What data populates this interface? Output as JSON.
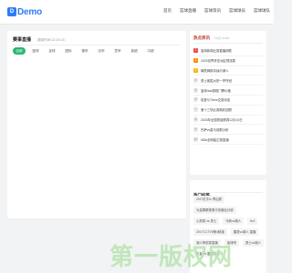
{
  "header": {
    "logo_badge": "D",
    "logo_text": "Demo",
    "nav": [
      "首页",
      "篮球直播",
      "篮球资讯",
      "篮球球员",
      "篮球球队"
    ]
  },
  "schedule": {
    "title": "赛事直播",
    "subtitle": "（更新时间 12-09-01）",
    "tabs": [
      "全部",
      "篮球",
      "足球",
      "国际",
      "德甲",
      "法甲",
      "意甲",
      "英超",
      "中超"
    ],
    "active_tab": 0
  },
  "hot": {
    "title": "热点资讯",
    "subtitle": "（今日 12:00）",
    "items": [
      "篮球新闻比赛直播前瞻",
      "2023世界杯亚洲区预选赛",
      "曝詹姆斯将续约湖人",
      "勇士客胜太阳一举夺冠",
      "篮球nba赛程门票价格",
      "哈登与76ers交易消息",
      "第十三场比赛精彩回顾",
      "2023年全国男篮联赛12月10日",
      "巴萨vs皇马前瞻分析",
      "NBA全明星正赛直播"
    ]
  },
  "tags": {
    "title": "热门标签",
    "items": [
      "2017红牛tv 季后赛",
      "为莫鹰眼视角中央最后分钟",
      "火箭赛 vs 勇士",
      "马刺vs湖人",
      "tiv2",
      "2017CCTV5第4频道",
      "雷霆vs湖人 直播",
      "湖人季前赛直播",
      "篮球吧",
      "勇士vs湖人",
      "王者 vs 雷霆角逐"
    ]
  },
  "watermark": "第一版权网",
  "colors": {
    "brand": "#2e7cf6",
    "accent": "#2bb673",
    "hot_title": "#c0392b"
  }
}
